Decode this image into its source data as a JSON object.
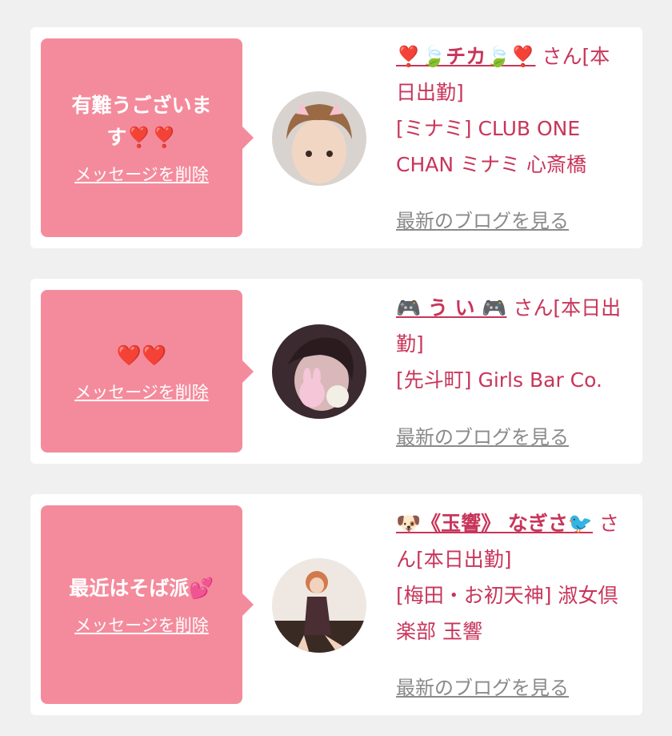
{
  "cards": [
    {
      "message": "有難うございます❣️❣️",
      "delete_label": "メッセージを削除",
      "name": "❣️🍃チカ🍃❣️",
      "name_suffix": "さん[本日出勤]",
      "shop": "[ミナミ] CLUB ONE CHAN ミナミ 心斎橋",
      "blog_label": "最新のブログを見る"
    },
    {
      "message": "❤️❤️",
      "delete_label": "メッセージを削除",
      "name": "🎮 う い 🎮",
      "name_suffix": "さん[本日出勤]",
      "shop": "[先斗町] Girls Bar Co.",
      "blog_label": "最新のブログを見る"
    },
    {
      "message": "最近はそば派💕",
      "delete_label": "メッセージを削除",
      "name": "🐶《玉響》 なぎさ🐦",
      "name_suffix": "さん[本日出勤]",
      "shop": "[梅田・お初天神] 淑女倶楽部 玉響",
      "blog_label": "最新のブログを見る"
    }
  ],
  "colors": {
    "background": "#f0f0f0",
    "card": "#ffffff",
    "bubble": "#f48b9c",
    "accent": "#c8355a",
    "link_gray": "#8a8a8a"
  }
}
